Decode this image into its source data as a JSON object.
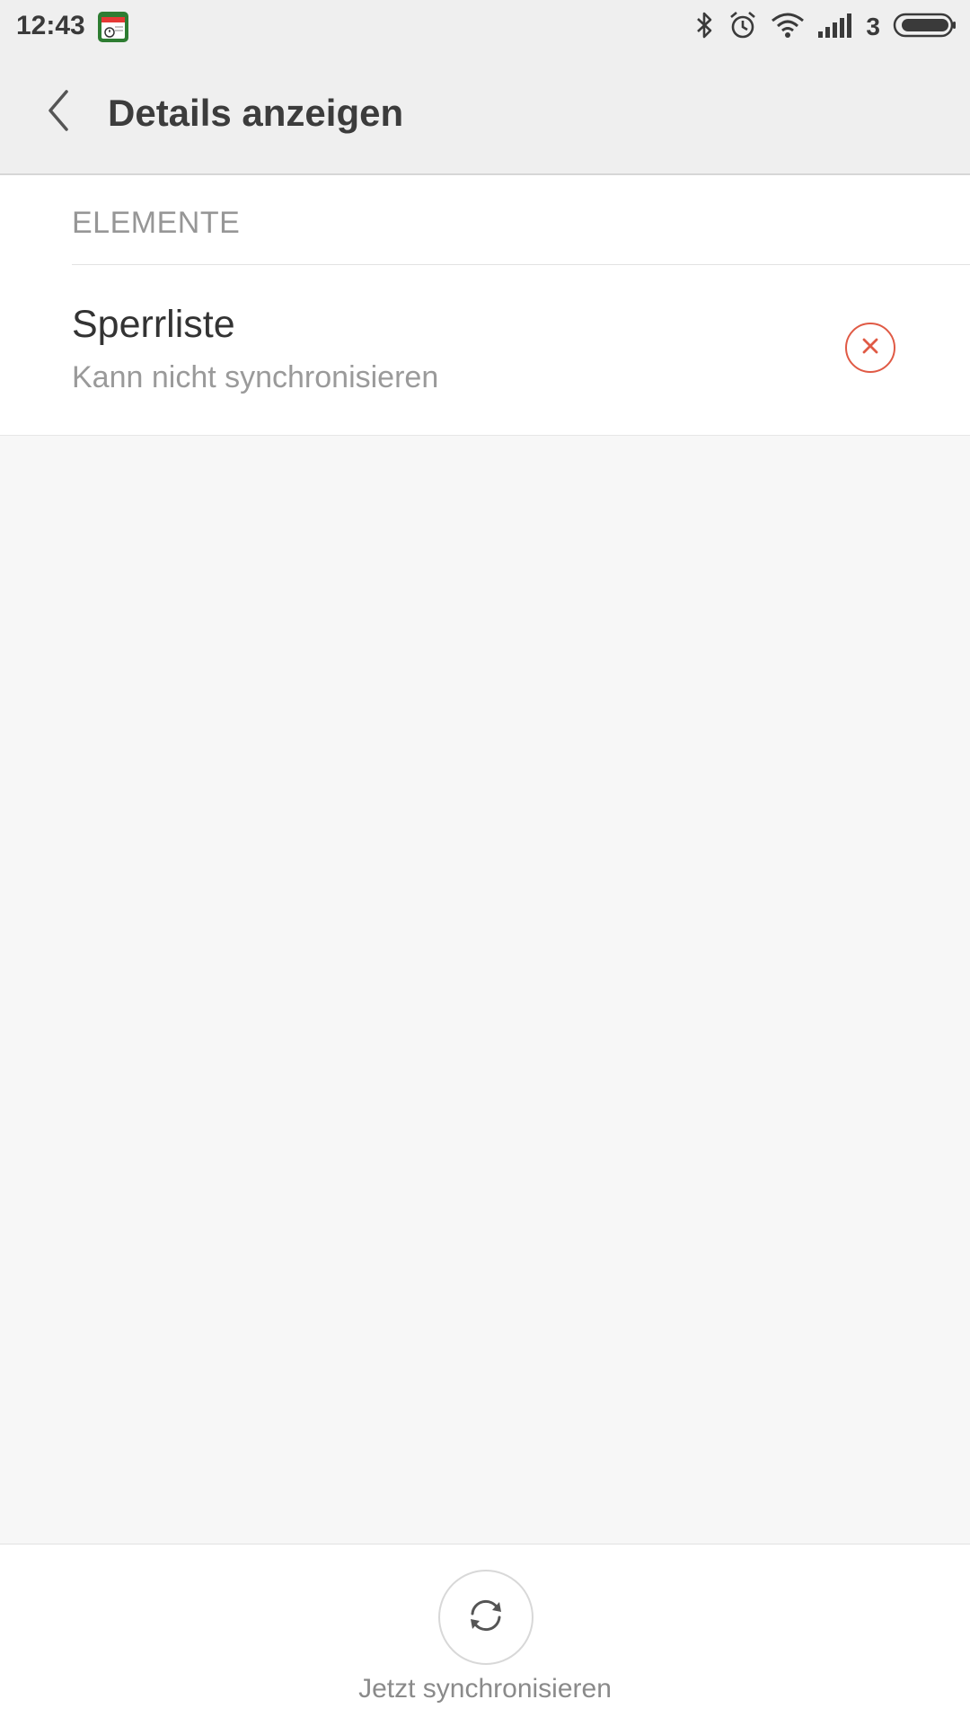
{
  "status_bar": {
    "time": "12:43",
    "sim_label": "3",
    "icons": [
      "calendar-app-icon",
      "bluetooth-icon",
      "alarm-icon",
      "wifi-icon",
      "signal-icon",
      "battery-icon"
    ]
  },
  "action_bar": {
    "title": "Details anzeigen",
    "back_icon": "chevron-left-icon"
  },
  "section": {
    "header": "ELEMENTE"
  },
  "items": [
    {
      "title": "Sperrliste",
      "subtitle": "Kann nicht synchronisieren",
      "status_icon": "error-x-icon"
    }
  ],
  "bottom": {
    "sync_label": "Jetzt synchronisieren",
    "sync_icon": "sync-icon"
  },
  "colors": {
    "accent_error": "#e05a45",
    "background": "#f7f7f7",
    "bar_background": "#efefef"
  }
}
